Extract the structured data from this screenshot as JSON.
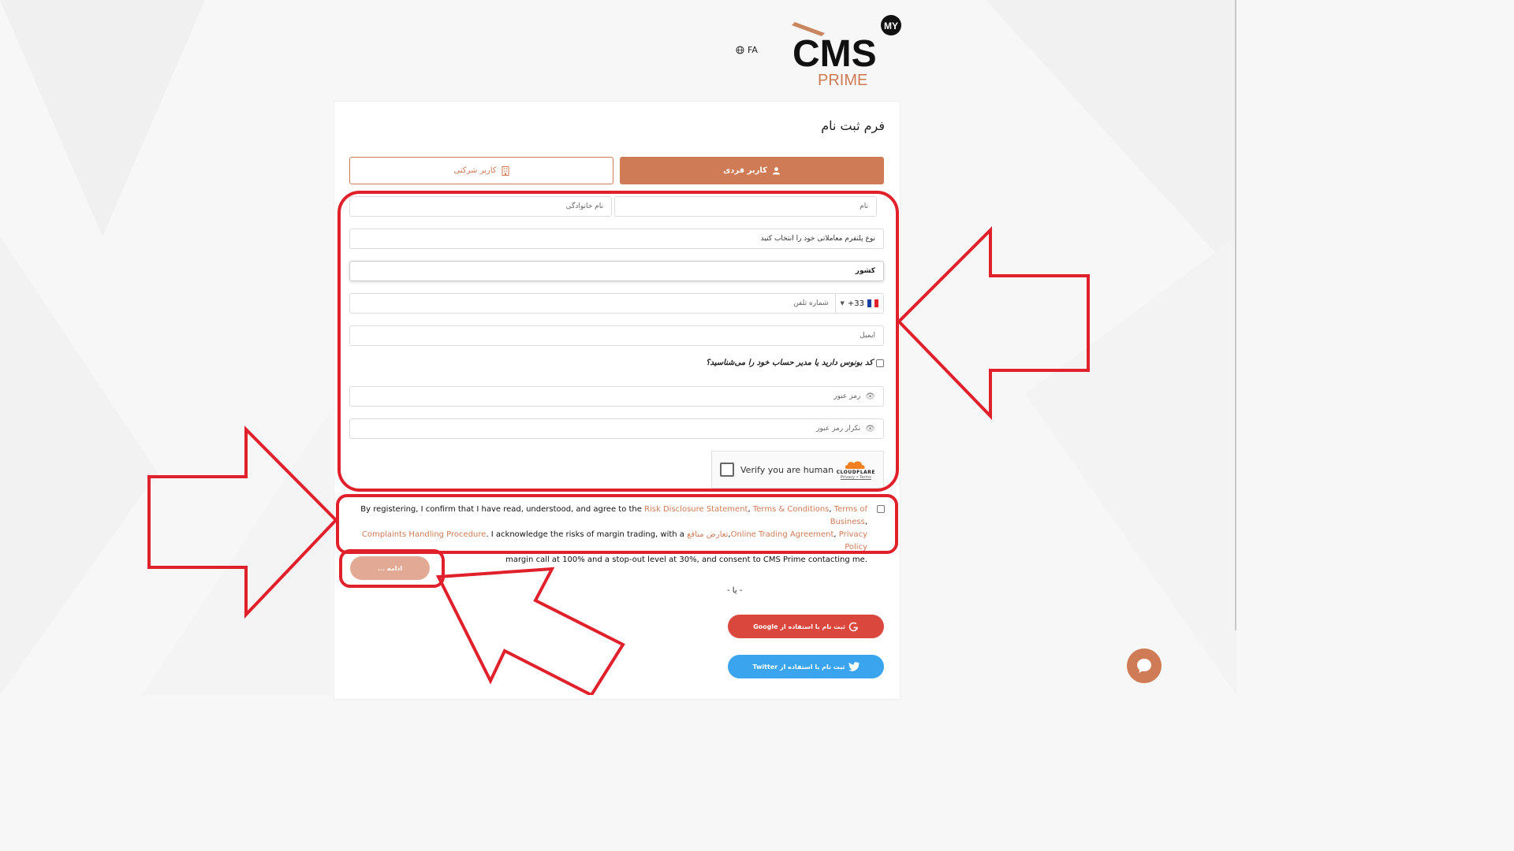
{
  "header": {
    "logo": {
      "my": "MY",
      "cms": "CMS",
      "prime": "PRIME"
    },
    "language": "FA"
  },
  "form": {
    "title": "فرم ثبت نام",
    "tabs": {
      "individual": "کاربر فردی",
      "company": "کاربر شرکتی"
    },
    "first_name_placeholder": "نام",
    "last_name_placeholder": "نام خانوادگی",
    "platform_placeholder": "نوع پلتفرم معاملاتی خود را انتخاب کنید",
    "country_label": "کشور",
    "phone": {
      "code": "+33",
      "placeholder": "شماره تلفن"
    },
    "email_placeholder": "ایمیل",
    "bonus_label": "کد بونوس دارید یا مدیر حساب خود را می‌شناسید؟",
    "password_placeholder": "رمز عبور",
    "password_repeat_placeholder": "تکرار رمز عبور",
    "captcha": {
      "label": "Verify you are human",
      "brand": "CLOUDFLARE",
      "privacy": "Privacy",
      "dot": "•",
      "terms": "Terms"
    },
    "terms": {
      "t1": "By registering, I confirm that I have read, understood, and agree to the ",
      "l1": "Risk Disclosure Statement",
      "s1": ", ",
      "l2": "Terms & Conditions",
      "s2": ", ",
      "l3": "Terms of Business",
      "s3": ", ",
      "l4": "Complaints Handling Procedure",
      "t2": ". I acknowledge the risks of margin trading, with a ",
      "l5": "تعارض منافع",
      "s5": ",",
      "l6": "Online Trading Agreement",
      "s6": ", ",
      "l7": "Privacy Policy",
      "t3": "margin call at 100% and a stop-out level at 30%, and consent to CMS Prime contacting me."
    },
    "continue_label": "ادامه ...",
    "or_label": "- یا -",
    "google_label": "ثبت نام با استفاده از Google",
    "twitter_label": "ثبت نام با استفاده از Twitter"
  },
  "colors": {
    "accent": "#cf7b56",
    "google": "#d9473d",
    "twitter": "#3aa4ef",
    "annotation": "#e0202a"
  },
  "icons": [
    "globe-icon",
    "user-icon",
    "building-icon",
    "eye-off-icon",
    "cloudflare-icon",
    "google-icon",
    "twitter-icon",
    "chat-icon"
  ]
}
